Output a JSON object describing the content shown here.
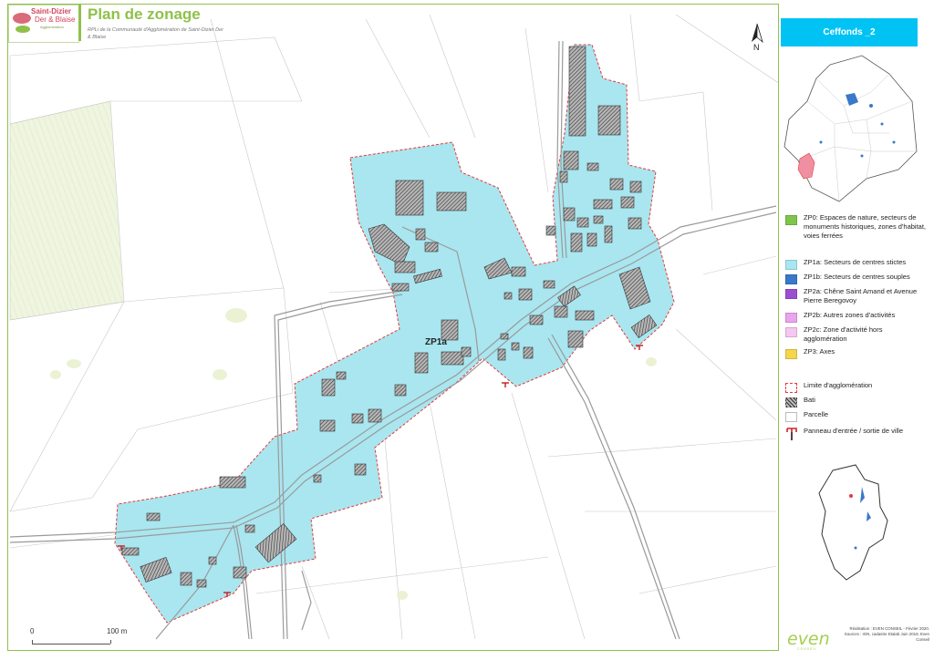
{
  "header": {
    "logo_line1": "Saint-Dizier",
    "logo_line2": "Der & Blaise",
    "logo_line3": "Agglomération",
    "title": "Plan de zonage",
    "subtitle": "RPLi de la Communauté d'Agglomération de Saint-Dizier Der & Blaise"
  },
  "map": {
    "north_label": "N",
    "zone_label": "ZP1a",
    "scale": {
      "start": "0",
      "end": "100 m"
    }
  },
  "sidebar": {
    "commune": "Ceffonds _2",
    "legend": [
      {
        "label": "ZP0: Espaces de nature, secteurs de monuments historiques, zones d'habitat, voies ferrées",
        "color": "#7dc64a"
      },
      {
        "label": "ZP1a: Secteurs de centres stictes",
        "color": "#a8e7f1"
      },
      {
        "label": "ZP1b: Secteurs de centres souples",
        "color": "#3a78c9"
      },
      {
        "label": "ZP2a: Chêne Saint Amand et Avenue Pierre Beregovoy",
        "color": "#9b4fd0"
      },
      {
        "label": "ZP2b: Autres zones d'activités",
        "color": "#eaa3ef"
      },
      {
        "label": "ZP2c: Zone d'activité hors agglomération",
        "color": "#f6c8f1"
      },
      {
        "label": "ZP3: Axes",
        "color": "#f5d64a"
      },
      {
        "label": "Limite d'agglomération",
        "color": "#e03b3b"
      },
      {
        "label": "Bati",
        "color": "#555555"
      },
      {
        "label": "Parcelle",
        "color": "#ffffff"
      },
      {
        "label": "Panneau d'entrée / sortie de ville",
        "color": "#c62828"
      }
    ],
    "credits": "Réalisation : EVEN CONSEIL - Février 2020. Sources : IGN, cadastre Etalab Juin 2019, Even Conseil",
    "brand": "even",
    "brand_sub": "CONSEIL"
  }
}
